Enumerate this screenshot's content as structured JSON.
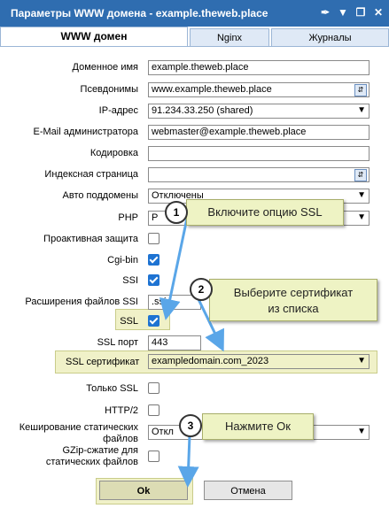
{
  "window": {
    "title": "Параметры WWW домена - example.theweb.place",
    "icons": [
      "broom-icon",
      "filter-icon",
      "restore-icon",
      "close-icon"
    ]
  },
  "tabs": [
    {
      "label": "WWW домен",
      "active": true
    },
    {
      "label": "Nginx",
      "active": false
    },
    {
      "label": "Журналы",
      "active": false
    }
  ],
  "form": {
    "domain_name": {
      "label": "Доменное имя",
      "value": "example.theweb.place"
    },
    "aliases": {
      "label": "Псевдонимы",
      "value": "www.example.theweb.place"
    },
    "ip": {
      "label": "IP-адрес",
      "value": "91.234.33.250 (shared)"
    },
    "email": {
      "label": "E-Mail администратора",
      "value": "webmaster@example.theweb.place"
    },
    "encoding": {
      "label": "Кодировка",
      "value": ""
    },
    "index_page": {
      "label": "Индексная страница",
      "value": ""
    },
    "auto_subdomains": {
      "label": "Авто поддомены",
      "value": "Отключены"
    },
    "php": {
      "label": "PHP",
      "value": "P"
    },
    "proactive": {
      "label": "Проактивная защита",
      "checked": false
    },
    "cgi": {
      "label": "Cgi-bin",
      "checked": true
    },
    "ssi": {
      "label": "SSI",
      "checked": true
    },
    "ssi_ext": {
      "label": "Расширения файлов SSI",
      "value": ".ssi"
    },
    "ssl": {
      "label": "SSL",
      "checked": true
    },
    "ssl_port": {
      "label": "SSL порт",
      "value": "443"
    },
    "ssl_cert": {
      "label": "SSL сертификат",
      "value": "exampledomain.com_2023"
    },
    "ssl_only": {
      "label": "Только SSL",
      "checked": false
    },
    "http2": {
      "label": "HTTP/2",
      "checked": false
    },
    "cache_static": {
      "label1": "Кеширование статических",
      "label2": "файлов",
      "value": "Откл"
    },
    "gzip": {
      "label1": "GZip-сжатие для",
      "label2": "статических файлов",
      "checked": false
    }
  },
  "buttons": {
    "ok": "Ok",
    "cancel": "Отмена"
  },
  "callouts": {
    "c1": {
      "num": "1",
      "text": "Включите опцию SSL"
    },
    "c2": {
      "num": "2",
      "text1": "Выберите сертификат",
      "text2": "из списка"
    },
    "c3": {
      "num": "3",
      "text": "Нажмите Ок"
    }
  },
  "colors": {
    "titlebar": "#2f6db0",
    "highlight": "#f0f1c8",
    "callout": "#eef3c4",
    "arrow": "#5aa6e8",
    "checkbox": "#1e73d2"
  }
}
